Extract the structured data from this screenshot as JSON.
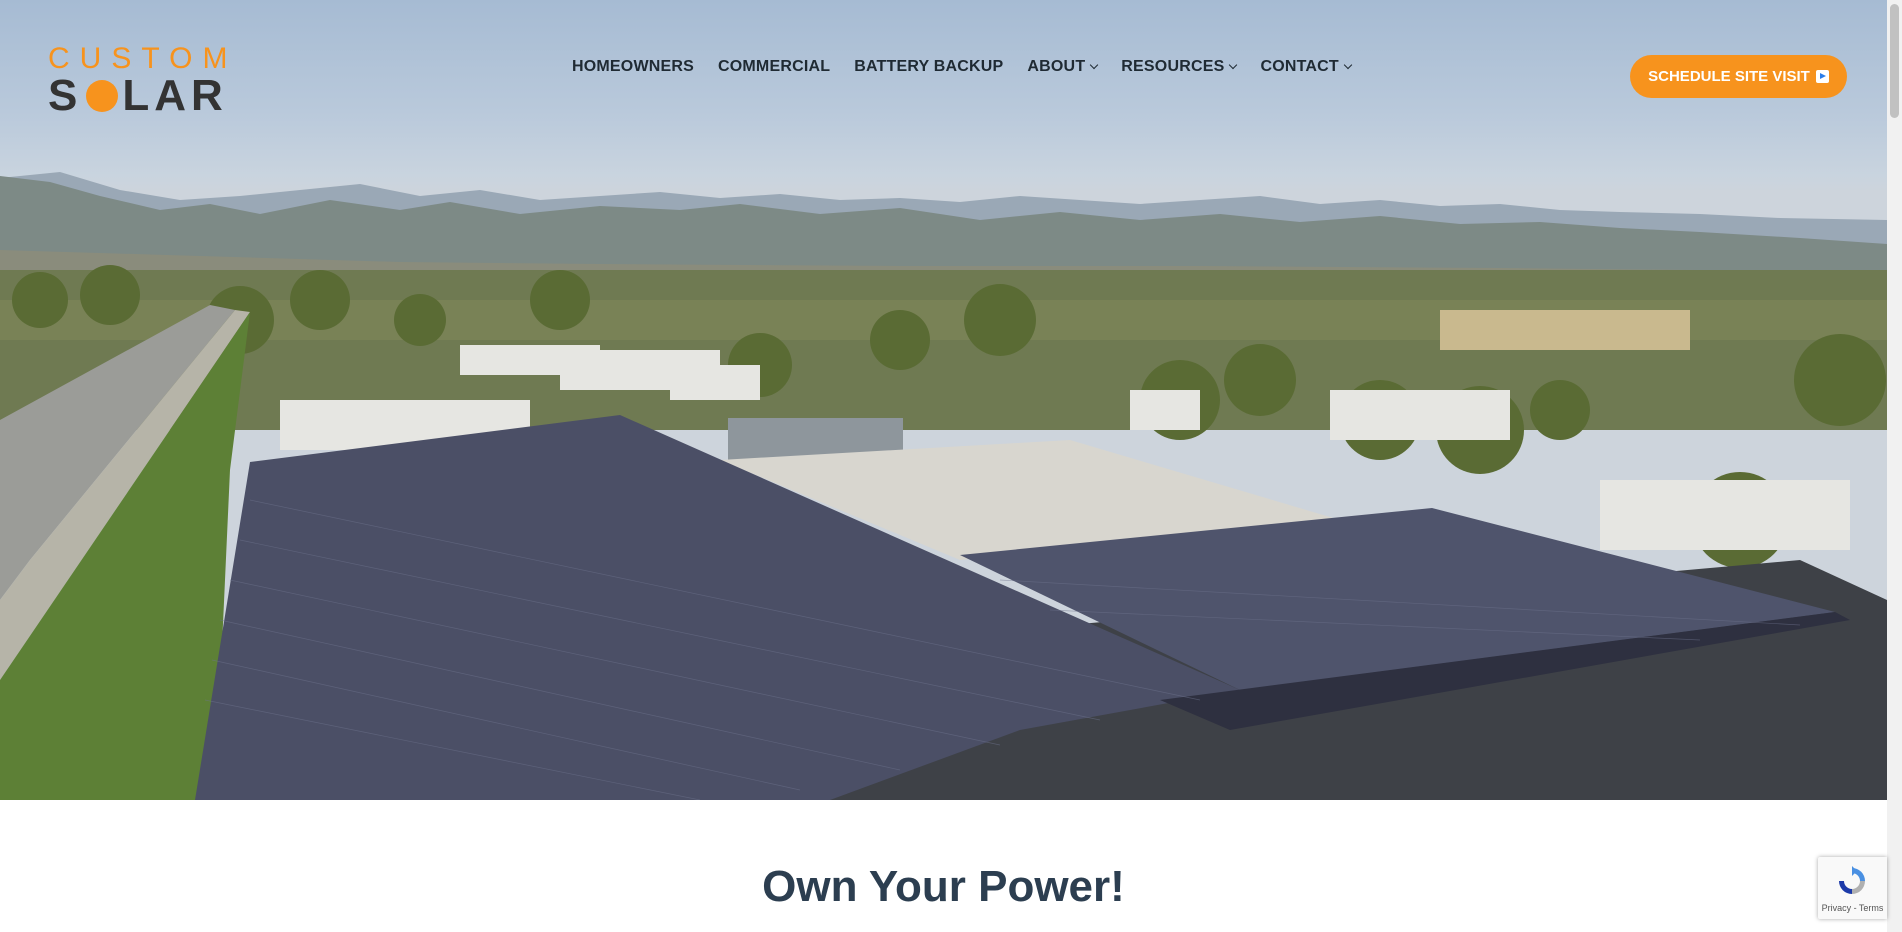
{
  "brand": {
    "logo_top": "CUSTOM",
    "logo_bottom_left": "S",
    "logo_bottom_right": "LAR",
    "accent": "#f7931d",
    "dark": "#333333"
  },
  "nav": {
    "items": [
      {
        "label": "HOMEOWNERS",
        "dropdown": false
      },
      {
        "label": "COMMERCIAL",
        "dropdown": false
      },
      {
        "label": "BATTERY BACKUP",
        "dropdown": false
      },
      {
        "label": "ABOUT",
        "dropdown": true
      },
      {
        "label": "RESOURCES",
        "dropdown": true
      },
      {
        "label": "CONTACT",
        "dropdown": true
      }
    ]
  },
  "cta": {
    "label": "SCHEDULE SITE VISIT",
    "icon": "play-icon"
  },
  "hero": {
    "image": "aerial-solar-carport-photo"
  },
  "headline": "Own Your Power!",
  "recaptcha": {
    "text": "Privacy - Terms",
    "icon": "recaptcha-icon"
  }
}
